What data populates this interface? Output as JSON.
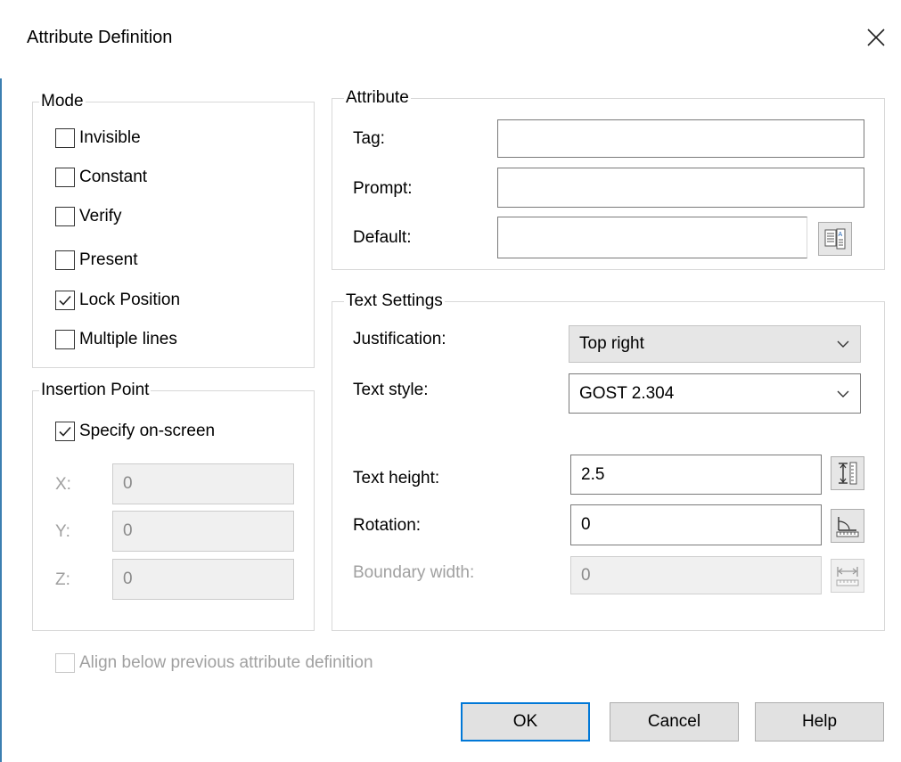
{
  "window": {
    "title": "Attribute Definition",
    "close_icon": "close-icon",
    "accent_color": "#0078d7"
  },
  "mode": {
    "title": "Mode",
    "options": [
      {
        "label": "Invisible",
        "checked": false
      },
      {
        "label": "Constant",
        "checked": false
      },
      {
        "label": "Verify",
        "checked": false
      },
      {
        "label": "Present",
        "checked": false
      },
      {
        "label": "Lock Position",
        "checked": true
      },
      {
        "label": "Multiple lines",
        "checked": false
      }
    ]
  },
  "insertion": {
    "title": "Insertion Point",
    "specify_label": "Specify on-screen",
    "specify_checked": true,
    "x_label": "X:",
    "x_value": "0",
    "y_label": "Y:",
    "y_value": "0",
    "z_label": "Z:",
    "z_value": "0"
  },
  "attribute": {
    "title": "Attribute",
    "tag_label": "Tag:",
    "tag_value": "",
    "prompt_label": "Prompt:",
    "prompt_value": "",
    "default_label": "Default:",
    "default_value": "",
    "insert_field_icon": "insert-field-icon"
  },
  "text_settings": {
    "title": "Text Settings",
    "justification_label": "Justification:",
    "justification_value": "Top right",
    "text_style_label": "Text style:",
    "text_style_value": "GOST 2.304",
    "text_height_label": "Text height:",
    "text_height_value": "2.5",
    "text_height_icon": "pick-height-icon",
    "rotation_label": "Rotation:",
    "rotation_value": "0",
    "rotation_icon": "pick-rotation-icon",
    "boundary_label": "Boundary width:",
    "boundary_value": "0",
    "boundary_icon": "pick-width-icon"
  },
  "align_label": "Align below previous attribute definition",
  "buttons": {
    "ok": "OK",
    "cancel": "Cancel",
    "help": "Help"
  }
}
